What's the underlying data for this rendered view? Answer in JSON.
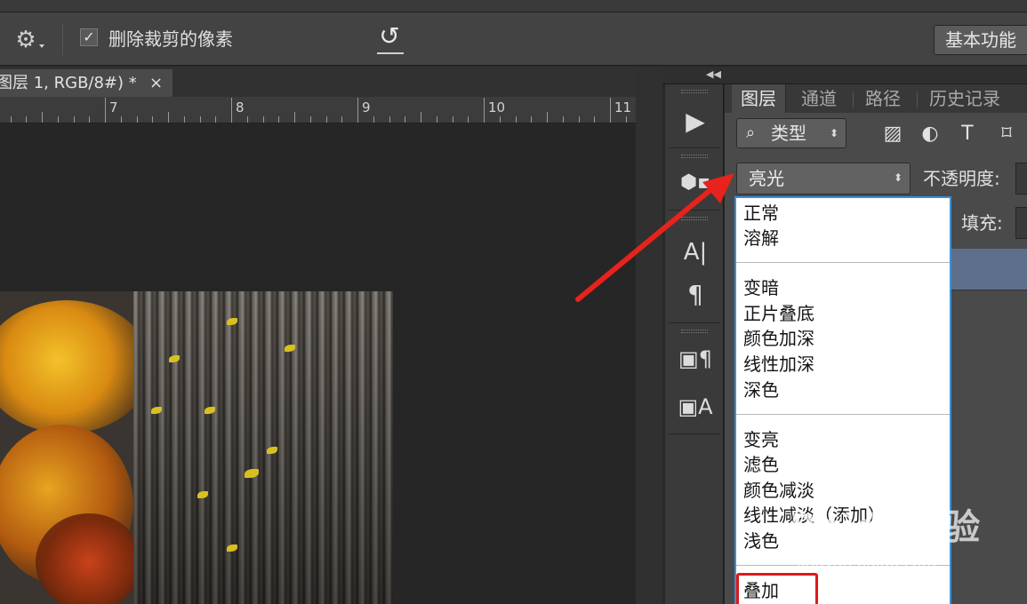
{
  "toolbar": {
    "settings_icon": "gear-icon",
    "delete_cropped_checked": true,
    "delete_cropped_label": "删除裁剪的像素",
    "reset_icon": "undo-icon",
    "workspace_label": "基本功能"
  },
  "document": {
    "tab_title": "图层 1, RGB/8#) *",
    "close_icon": "close-icon",
    "ruler_labels": [
      "7",
      "8",
      "9",
      "10",
      "11"
    ]
  },
  "panel": {
    "collapse_icon": "double-chevron-left-icon",
    "tabs": [
      "图层",
      "通道",
      "路径",
      "历史记录"
    ],
    "filter": {
      "icon": "search-icon",
      "label": "类型"
    },
    "filter_icons": [
      "image-filter-icon",
      "adjustment-filter-icon",
      "type-filter-icon",
      "shape-filter-icon"
    ],
    "blend_mode": "亮光",
    "opacity_label": "不透明度:",
    "fill_label": "填充:"
  },
  "tools": [
    "play-icon",
    "3d-icon",
    "character-icon",
    "paragraph-icon",
    "paragraph-styles-icon",
    "character-styles-icon"
  ],
  "blend_menu": {
    "groups": [
      [
        "正常",
        "溶解"
      ],
      [
        "变暗",
        "正片叠底",
        "颜色加深",
        "线性加深",
        "深色"
      ],
      [
        "变亮",
        "滤色",
        "颜色减淡",
        "线性减淡（添加）",
        "浅色"
      ],
      [
        "叠加"
      ]
    ],
    "highlighted": "叠加"
  },
  "watermark": {
    "main": "Baidu经验",
    "sub": "jingyan.baidu.com"
  },
  "colors": {
    "highlight": "#e01818",
    "arrow": "#e6231c",
    "menu_border": "#3b8fd4"
  }
}
